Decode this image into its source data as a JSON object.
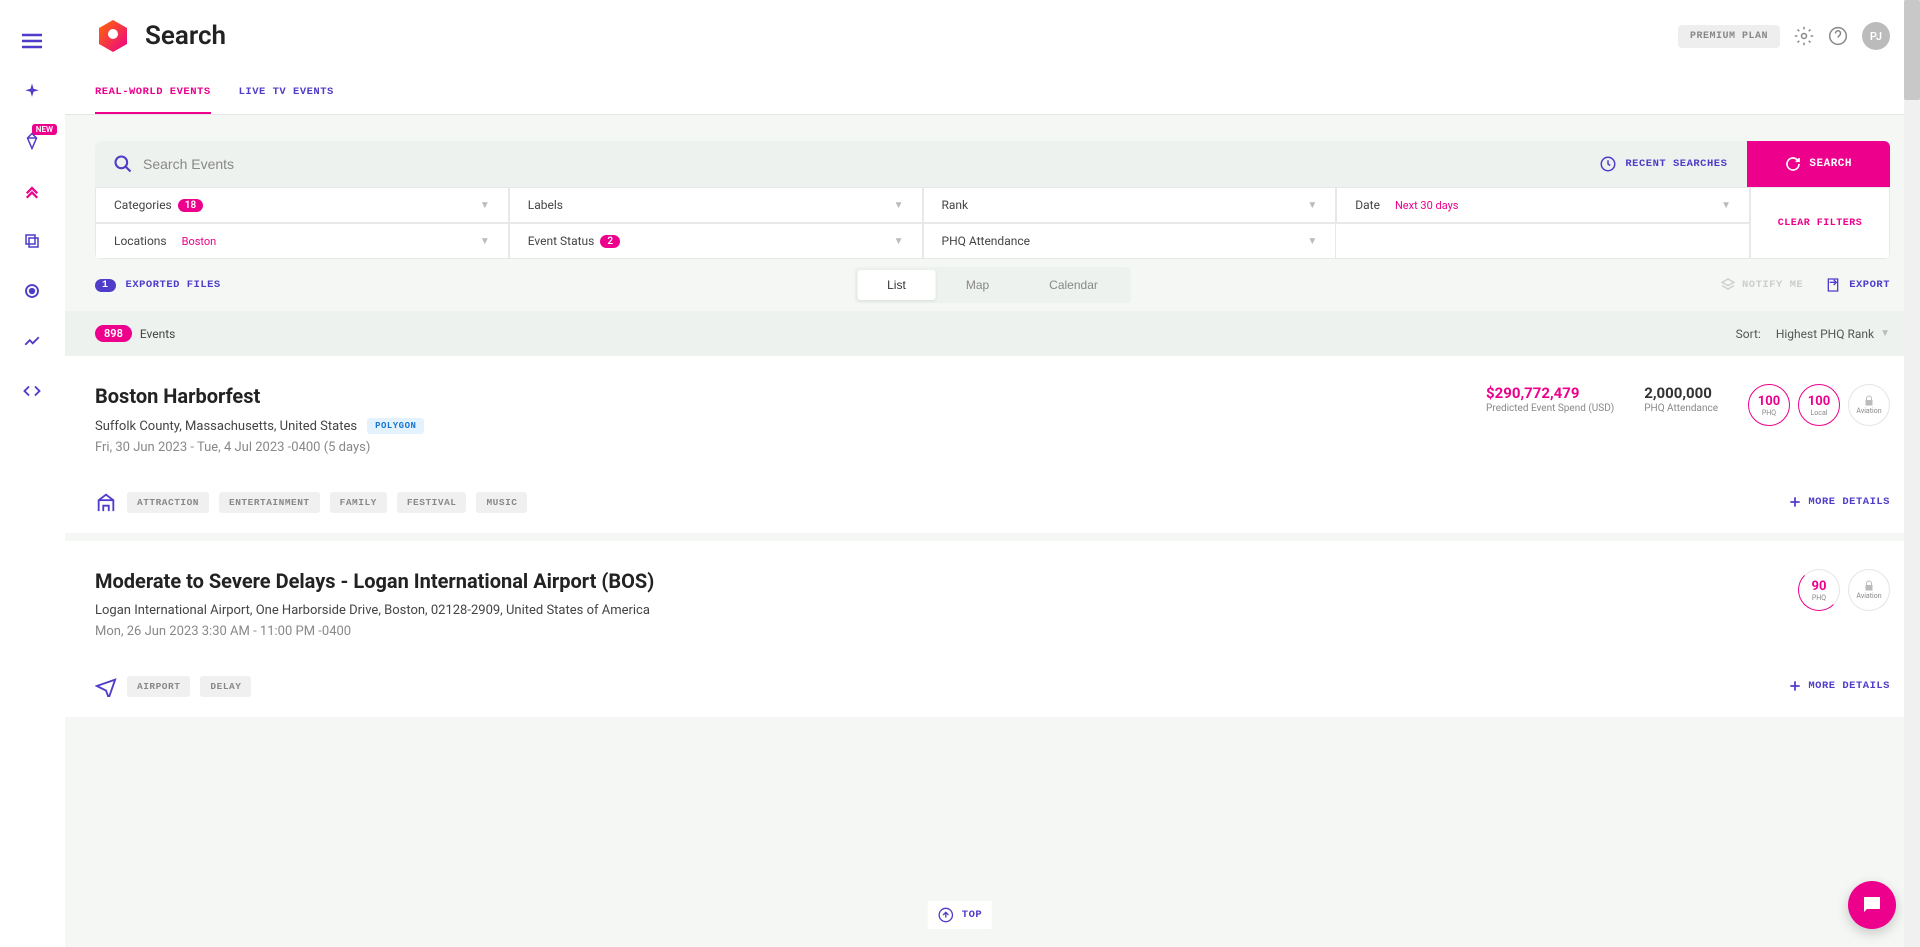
{
  "header": {
    "title": "Search",
    "premium_label": "PREMIUM PLAN",
    "avatar": "PJ",
    "sidebar_badge": "NEW"
  },
  "tabs": {
    "real_world": "REAL-WORLD EVENTS",
    "live_tv": "LIVE TV EVENTS"
  },
  "search": {
    "placeholder": "Search Events",
    "recent": "RECENT SEARCHES",
    "button": "SEARCH",
    "clear": "CLEAR FILTERS"
  },
  "filters": {
    "categories": {
      "label": "Categories",
      "count": "18"
    },
    "labels": {
      "label": "Labels"
    },
    "rank": {
      "label": "Rank"
    },
    "date": {
      "label": "Date",
      "value": "Next 30 days"
    },
    "locations": {
      "label": "Locations",
      "value": "Boston"
    },
    "event_status": {
      "label": "Event Status",
      "count": "2"
    },
    "phq_attendance": {
      "label": "PHQ Attendance"
    }
  },
  "toolbar": {
    "exported_count": "1",
    "exported_label": "EXPORTED FILES",
    "views": {
      "list": "List",
      "map": "Map",
      "calendar": "Calendar"
    },
    "notify": "NOTIFY ME",
    "export": "EXPORT"
  },
  "results": {
    "count": "898",
    "label": "Events",
    "sort_prefix": "Sort:",
    "sort_value": "Highest PHQ Rank"
  },
  "events": [
    {
      "title": "Boston Harborfest",
      "location": "Suffolk County, Massachusetts, United States",
      "polygon": "POLYGON",
      "date": "Fri, 30 Jun 2023 - Tue, 4 Jul 2023 -0400 (5 days)",
      "spend_val": "$290,772,479",
      "spend_sub": "Predicted Event Spend (USD)",
      "attendance_val": "2,000,000",
      "attendance_sub": "PHQ Attendance",
      "scores": [
        {
          "val": "100",
          "lbl": "PHQ"
        },
        {
          "val": "100",
          "lbl": "Local"
        },
        {
          "locked": true,
          "lbl": "Aviation"
        }
      ],
      "tags": [
        "ATTRACTION",
        "ENTERTAINMENT",
        "FAMILY",
        "FESTIVAL",
        "MUSIC"
      ],
      "more": "MORE DETAILS"
    },
    {
      "title": "Moderate to Severe Delays - Logan International Airport (BOS)",
      "location": "Logan International Airport, One Harborside Drive, Boston, 02128-2909, United States of America",
      "date": "Mon, 26 Jun 2023 3:30 AM - 11:00 PM -0400",
      "scores": [
        {
          "val": "90",
          "lbl": "PHQ",
          "partial": true
        },
        {
          "locked": true,
          "lbl": "Aviation"
        }
      ],
      "tags": [
        "AIRPORT",
        "DELAY"
      ],
      "more": "MORE DETAILS"
    }
  ],
  "footer": {
    "top": "TOP"
  }
}
